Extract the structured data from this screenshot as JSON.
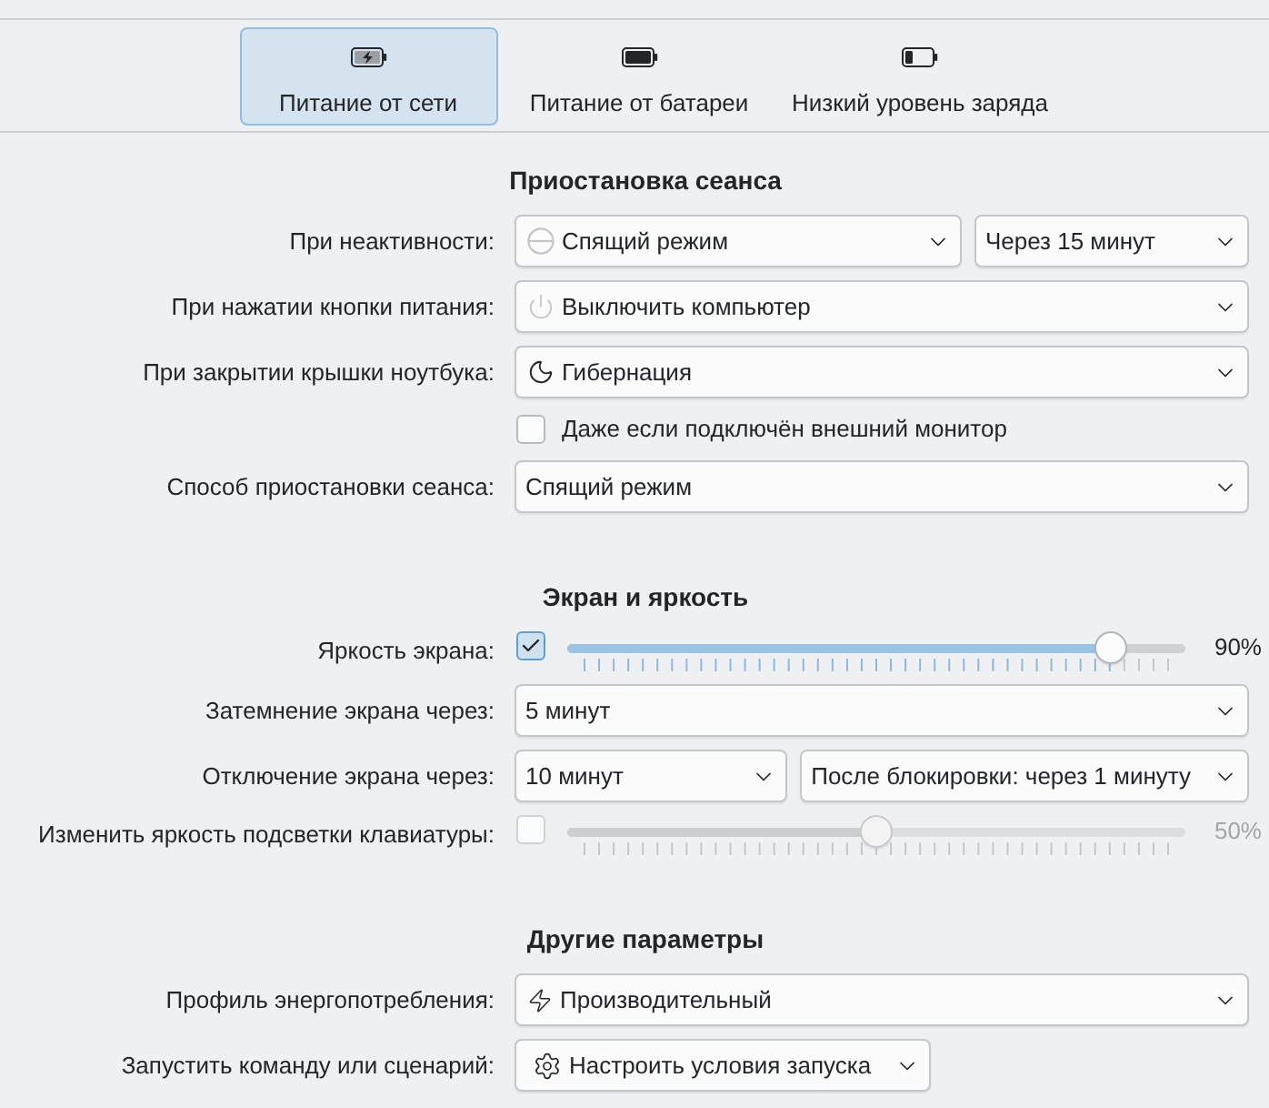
{
  "tabs": [
    {
      "label": "Питание от сети",
      "kind": "charging",
      "selected": true
    },
    {
      "label": "Питание от батареи",
      "kind": "full",
      "selected": false
    },
    {
      "label": "Низкий уровень заряда",
      "kind": "low",
      "selected": false
    }
  ],
  "sections": [
    {
      "title": "Приостановка сеанса",
      "rows": [
        {
          "kind": "combos",
          "label": "При неактивности:",
          "controls": [
            {
              "value": "Спящий режим"
            },
            {
              "value": "Через 15 минут"
            }
          ]
        },
        {
          "kind": "combos",
          "label": "При нажатии кнопки питания:",
          "controls": [
            {
              "value": "Выключить компьютер"
            }
          ]
        },
        {
          "kind": "combos",
          "label": "При закрытии крышки ноутбука:",
          "controls": [
            {
              "value": "Гибернация"
            }
          ]
        },
        {
          "kind": "checkbox",
          "text": "Даже если подключён внешний монитор",
          "checked": false
        },
        {
          "kind": "combos",
          "label": "Способ приостановки сеанса:",
          "controls": [
            {
              "value": "Спящий режим"
            }
          ]
        }
      ]
    },
    {
      "title": "Экран и яркость",
      "rows": [
        {
          "kind": "slider",
          "label": "Яркость экрана:",
          "checked": true,
          "level": 0.9,
          "reading": "90%",
          "disabled": false
        },
        {
          "kind": "combos",
          "label": "Затемнение экрана через:",
          "controls": [
            {
              "value": "5 минут"
            }
          ]
        },
        {
          "kind": "combos",
          "label": "Отключение экрана через:",
          "controls": [
            {
              "value": "10 минут"
            },
            {
              "value": "После блокировки: через 1 минуту"
            }
          ]
        },
        {
          "kind": "slider",
          "label": "Изменить яркость подсветки клавиатуры:",
          "checked": false,
          "level": 0.5,
          "reading": "50%",
          "disabled": true
        }
      ]
    },
    {
      "title": "Другие параметры",
      "rows": [
        {
          "kind": "combos",
          "label": "Профиль энергопотребления:",
          "controls": [
            {
              "value": "Производительный"
            }
          ]
        },
        {
          "kind": "menu-button",
          "label": "Запустить команду или сценарий:",
          "value": "Настроить условия запуска"
        }
      ]
    }
  ]
}
